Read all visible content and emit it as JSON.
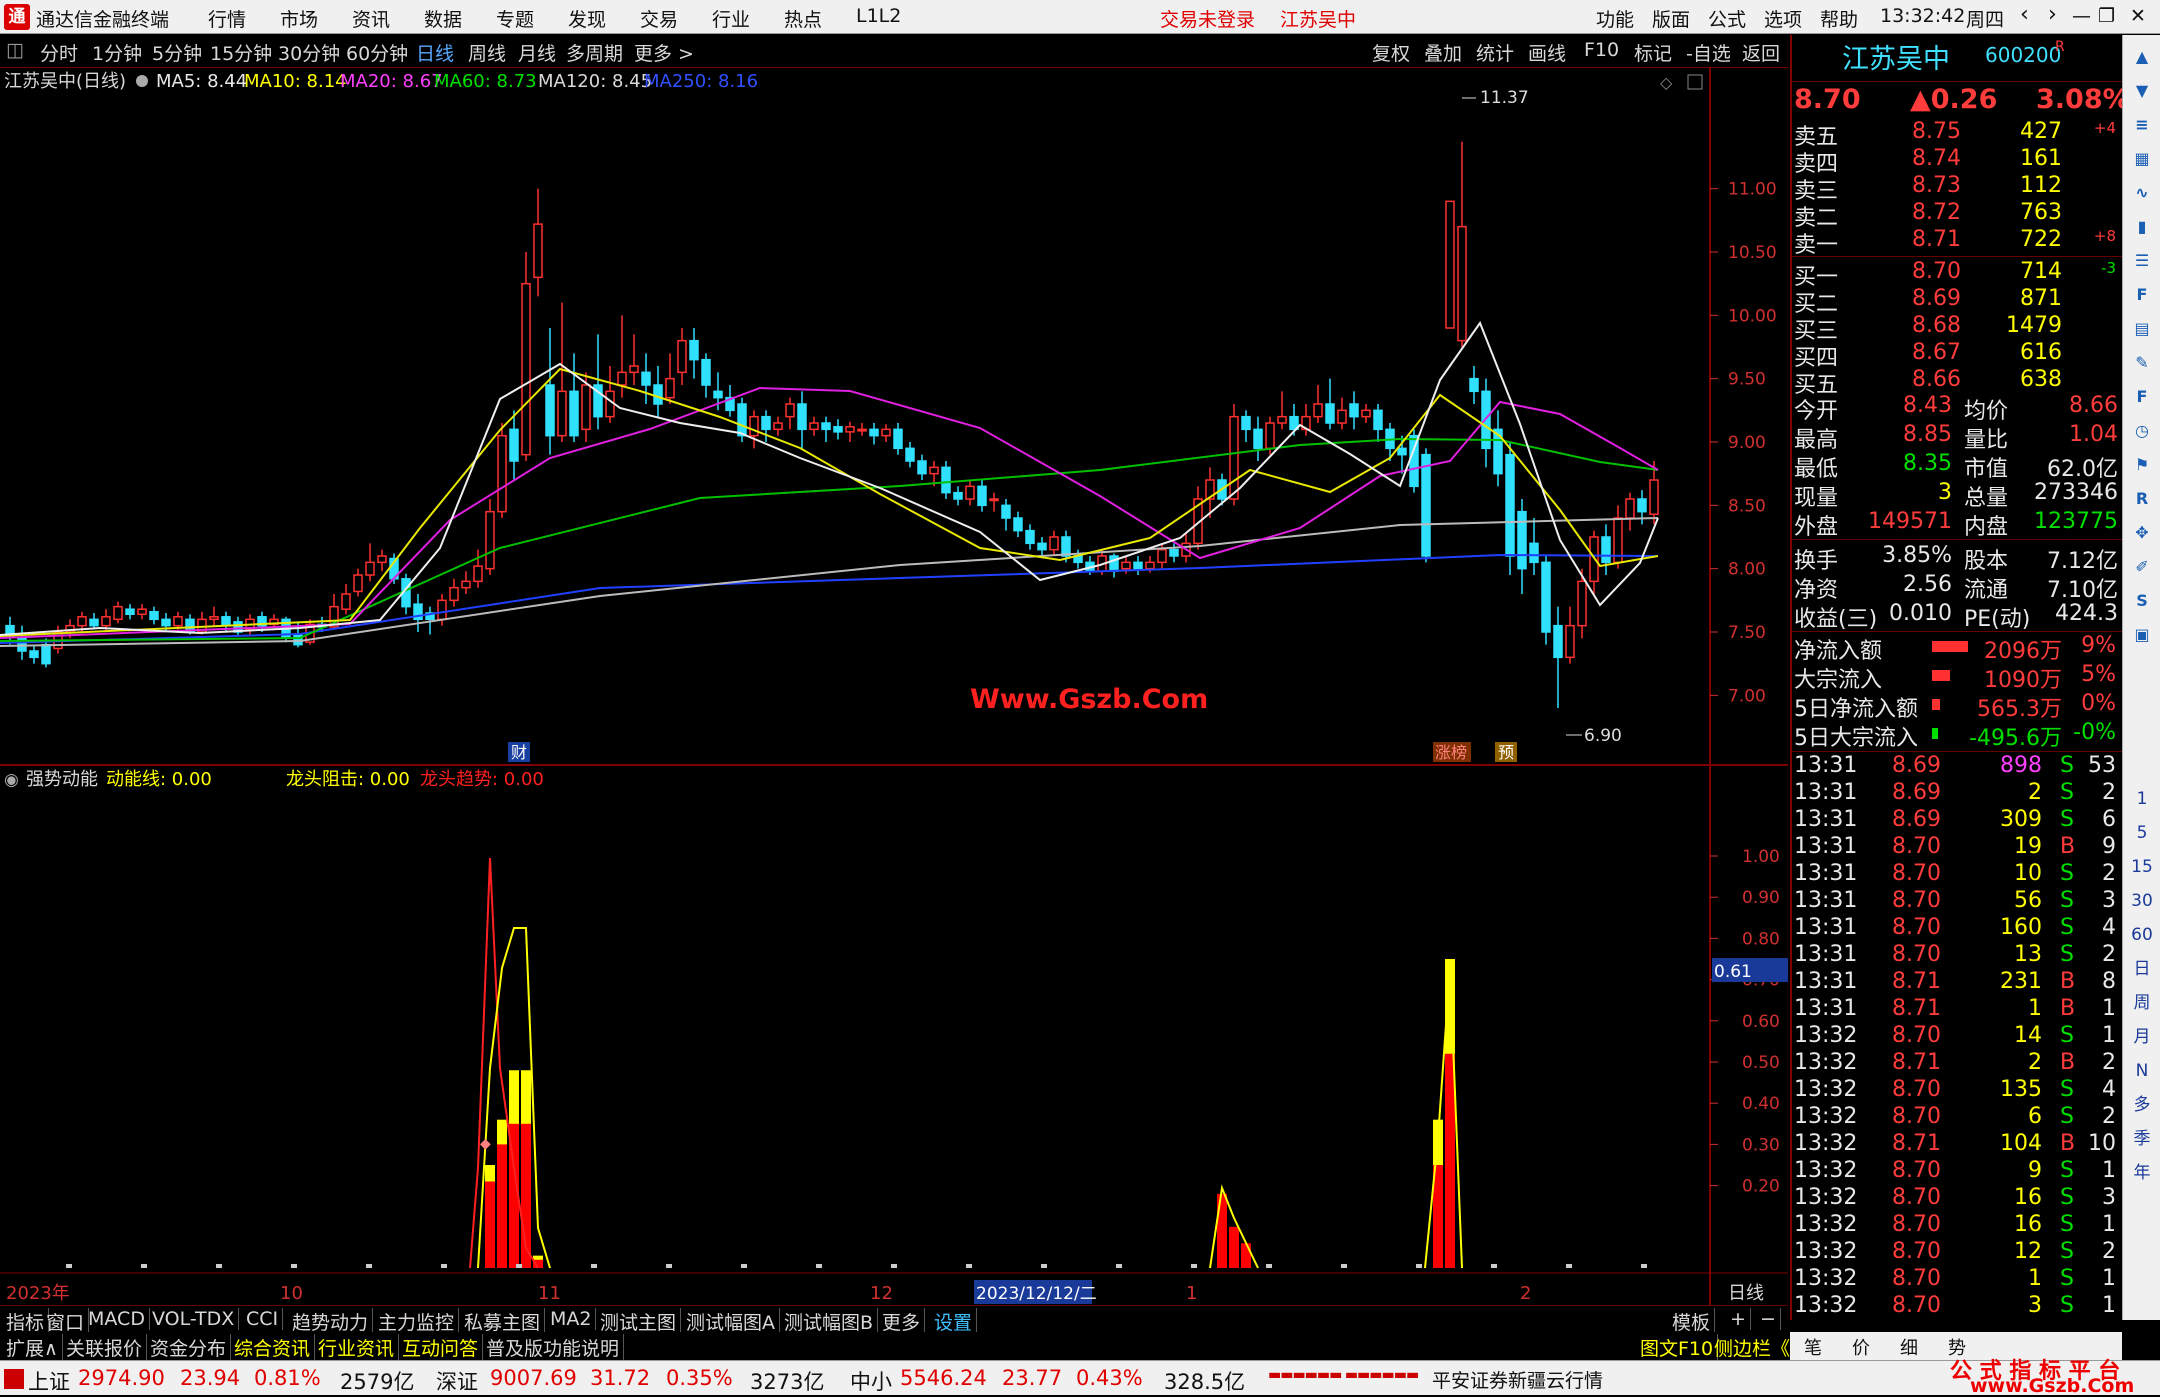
{
  "app": {
    "title": "通达信金融终端",
    "menu": [
      "行情",
      "市场",
      "资讯",
      "数据",
      "专题",
      "发现",
      "交易",
      "行业",
      "热点",
      "L1L2"
    ],
    "login": "交易未登录",
    "stock_title": "江苏吴中",
    "right_menu": [
      "功能",
      "版面",
      "公式",
      "选项",
      "帮助"
    ],
    "time": "13:32:42",
    "weekday": "周四"
  },
  "periods": [
    "分时",
    "1分钟",
    "5分钟",
    "15分钟",
    "30分钟",
    "60分钟",
    "日线",
    "周线",
    "月线",
    "多周期",
    "更多 >"
  ],
  "toolbar_right": [
    "复权",
    "叠加",
    "统计",
    "画线",
    "F10",
    "标记",
    "-自选",
    "返回"
  ],
  "chart_header": {
    "name": "江苏吴中(日线)",
    "ma5": "MA5: 8.44",
    "ma10": "MA10: 8.14",
    "ma20": "MA20: 8.67",
    "ma60": "MA60: 8.73",
    "ma120": "MA120: 8.45",
    "ma250": "MA250: 8.16"
  },
  "price_axis": [
    "11.00",
    "10.50",
    "10.00",
    "9.50",
    "9.00",
    "8.50",
    "8.00",
    "7.50",
    "7.00"
  ],
  "annotations": {
    "high": "11.37",
    "low": "6.90",
    "cai": "财",
    "zhangbang": "涨榜",
    "yu": "预",
    "watermark": "Www.Gszb.Com"
  },
  "indicator": {
    "name": "强势动能",
    "line1": "动能线: 0.00",
    "line2": "龙头阻击: 0.00",
    "line3": "龙头趋势: 0.00",
    "axis": [
      "1.00",
      "0.90",
      "0.80",
      "0.70",
      "0.60",
      "0.50",
      "0.40",
      "0.30",
      "0.20"
    ],
    "current": "0.61"
  },
  "date_axis": {
    "labels": [
      "2023年",
      "10",
      "11",
      "12",
      "1",
      "2"
    ],
    "highlight": "2023/12/12/二",
    "period": "日线"
  },
  "quote": {
    "name": "江苏吴中",
    "code": "600200",
    "r": "R",
    "price": "8.70",
    "change": "▲0.26",
    "pct": "3.08%",
    "asks": [
      {
        "l": "卖五",
        "p": "8.75",
        "v": "427",
        "d": "+4"
      },
      {
        "l": "卖四",
        "p": "8.74",
        "v": "161",
        "d": ""
      },
      {
        "l": "卖三",
        "p": "8.73",
        "v": "112",
        "d": ""
      },
      {
        "l": "卖二",
        "p": "8.72",
        "v": "763",
        "d": ""
      },
      {
        "l": "卖一",
        "p": "8.71",
        "v": "722",
        "d": "+8"
      }
    ],
    "bids": [
      {
        "l": "买一",
        "p": "8.70",
        "v": "714",
        "d": "-3"
      },
      {
        "l": "买二",
        "p": "8.69",
        "v": "871",
        "d": ""
      },
      {
        "l": "买三",
        "p": "8.68",
        "v": "1479",
        "d": ""
      },
      {
        "l": "买四",
        "p": "8.67",
        "v": "616",
        "d": ""
      },
      {
        "l": "买五",
        "p": "8.66",
        "v": "638",
        "d": ""
      }
    ],
    "stats": [
      [
        "今开",
        "8.43",
        "均价",
        "8.66"
      ],
      [
        "最高",
        "8.85",
        "量比",
        "1.04"
      ],
      [
        "最低",
        "8.35",
        "市值",
        "62.0亿"
      ],
      [
        "现量",
        "3",
        "总量",
        "273346"
      ],
      [
        "外盘",
        "149571",
        "内盘",
        "123775"
      ]
    ],
    "stats2": [
      [
        "换手",
        "3.85%",
        "股本",
        "7.12亿"
      ],
      [
        "净资",
        "2.56",
        "流通",
        "7.10亿"
      ],
      [
        "收益(三)",
        "0.010",
        "PE(动)",
        "424.3"
      ]
    ],
    "flows": [
      [
        "净流入额",
        "2096万",
        "9%"
      ],
      [
        "大宗流入",
        "1090万",
        "5%"
      ],
      [
        "5日净流入额",
        "565.3万",
        "0%"
      ],
      [
        "5日大宗流入",
        "-495.6万",
        "-0%"
      ]
    ]
  },
  "ticks": [
    [
      "13:31",
      "8.69",
      "898",
      "S",
      "53"
    ],
    [
      "13:31",
      "8.69",
      "2",
      "S",
      "2"
    ],
    [
      "13:31",
      "8.69",
      "309",
      "S",
      "6"
    ],
    [
      "13:31",
      "8.70",
      "19",
      "B",
      "9"
    ],
    [
      "13:31",
      "8.70",
      "10",
      "S",
      "2"
    ],
    [
      "13:31",
      "8.70",
      "56",
      "S",
      "3"
    ],
    [
      "13:31",
      "8.70",
      "160",
      "S",
      "4"
    ],
    [
      "13:31",
      "8.70",
      "13",
      "S",
      "2"
    ],
    [
      "13:31",
      "8.71",
      "231",
      "B",
      "8"
    ],
    [
      "13:31",
      "8.71",
      "1",
      "B",
      "1"
    ],
    [
      "13:32",
      "8.70",
      "14",
      "S",
      "1"
    ],
    [
      "13:32",
      "8.71",
      "2",
      "B",
      "2"
    ],
    [
      "13:32",
      "8.70",
      "135",
      "S",
      "4"
    ],
    [
      "13:32",
      "8.70",
      "6",
      "S",
      "2"
    ],
    [
      "13:32",
      "8.71",
      "104",
      "B",
      "10"
    ],
    [
      "13:32",
      "8.70",
      "9",
      "S",
      "1"
    ],
    [
      "13:32",
      "8.70",
      "16",
      "S",
      "3"
    ],
    [
      "13:32",
      "8.70",
      "16",
      "S",
      "1"
    ],
    [
      "13:32",
      "8.70",
      "12",
      "S",
      "2"
    ],
    [
      "13:32",
      "8.70",
      "1",
      "S",
      "1"
    ],
    [
      "13:32",
      "8.70",
      "3",
      "S",
      "1"
    ]
  ],
  "tabs1": [
    "指标",
    "窗口",
    "MACD",
    "VOL-TDX",
    "CCI",
    "趋势动力",
    "主力监控",
    "私募主图",
    "MA2",
    "测试主图",
    "测试幅图A",
    "测试幅图B",
    "更多",
    "设置"
  ],
  "tabs1_right": [
    "模板",
    "+",
    "−"
  ],
  "tabs2": [
    "扩展∧",
    "关联报价",
    "资金分布",
    "综合资讯",
    "行业资讯",
    "互动问答",
    "普及版功能说明"
  ],
  "tabs2_right": [
    "图文F10",
    "侧边栏《"
  ],
  "rp_tabs": [
    "笔",
    "价",
    "细",
    "势"
  ],
  "status": {
    "sh": "上证",
    "sh_v": "2974.90",
    "sh_c": "23.94",
    "sh_p": "0.81%",
    "sh_a": "2579亿",
    "sz": "深证",
    "sz_v": "9007.69",
    "sz_c": "31.72",
    "sz_p": "0.35%",
    "sz_a": "3273亿",
    "zx": "中小",
    "zx_v": "5546.24",
    "zx_c": "23.77",
    "zx_p": "0.43%",
    "zx_a": "328.5亿",
    "broker": "平安证券新疆云行情",
    "brand": "公 式 指 标 平 台",
    "brand_url": "www.Gszb.Com"
  },
  "sidebar_icons": [
    "arrow-up-icon",
    "arrow-down-icon",
    "list-icon",
    "table-icon",
    "chart-icon",
    "candle-icon",
    "doc-icon",
    "f10-icon",
    "grid-icon",
    "notes-icon",
    "f-icon",
    "clock-icon",
    "flag-icon",
    "rsi-icon",
    "move-icon",
    "pen-icon",
    "fs-icon",
    "gallery-icon"
  ],
  "sidebar_periods": [
    "1",
    "5",
    "15",
    "30",
    "60",
    "日",
    "周",
    "月",
    "N",
    "多",
    "季",
    "年"
  ],
  "chart_data": {
    "type": "candlestick",
    "price_ylim": [
      6.9,
      11.4
    ],
    "indicator_ylim": [
      0,
      1.0
    ]
  }
}
